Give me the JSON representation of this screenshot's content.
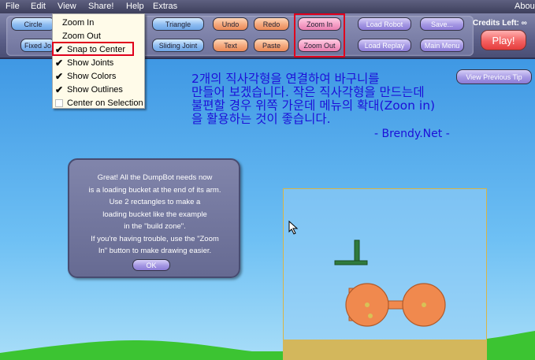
{
  "menubar": {
    "items": [
      "File",
      "Edit",
      "View",
      "Share!",
      "Help",
      "Extras"
    ],
    "right": "Abou"
  },
  "toolbar": {
    "row1": [
      "Circle",
      "Triangle",
      "Undo",
      "Redo",
      "Zoom In",
      "Load Robot",
      "Save..."
    ],
    "row2": [
      "Fixed Jo",
      "Sliding Joint",
      "Text",
      "Paste",
      "Zoom Out",
      "Load Replay",
      "Main Menu"
    ],
    "credits": "Credits Left: ∞",
    "play": "Play!"
  },
  "view_menu": {
    "items": [
      {
        "label": "Zoom In",
        "check": ""
      },
      {
        "label": "Zoom Out",
        "check": ""
      },
      {
        "label": "Snap to Center",
        "check": "✔"
      },
      {
        "label": "Show Joints",
        "check": "✔"
      },
      {
        "label": "Show Colors",
        "check": "✔"
      },
      {
        "label": "Show Outlines",
        "check": "✔"
      },
      {
        "label": "Center on Selection",
        "check": ""
      }
    ]
  },
  "tip_button": "View Previous Tip",
  "korean_tip": {
    "line1": "2개의 직사각형을 연결하여 바구니를",
    "line2": "만들어 보겠습니다. 작은 직사각형을 만드는데",
    "line3": "불편할 경우 위쪽 가운데 메뉴의 확대(Zoon in)",
    "line4": "을 활용하는 것이 좋습니다.",
    "signature": "- Brendy.Net -"
  },
  "message": {
    "lines": [
      "Great! All the DumpBot needs now",
      "is a loading bucket at the end of its arm.",
      "Use 2 rectangles to make a",
      "loading bucket like the example",
      "in the \"build zone\".",
      "If you're having trouble, use the \"Zoom",
      "In\" button to make drawing easier."
    ],
    "ok": "OK"
  },
  "colors": {
    "highlight_box": "#e0001c",
    "robot_orange": "#f0894e",
    "arm_green": "#2f7a3c",
    "ground_green": "#3cc432",
    "build_zone_border": "#d9b546"
  },
  "icons": {
    "cursor": "arrow-cursor-icon",
    "check": "checkmark-icon"
  }
}
